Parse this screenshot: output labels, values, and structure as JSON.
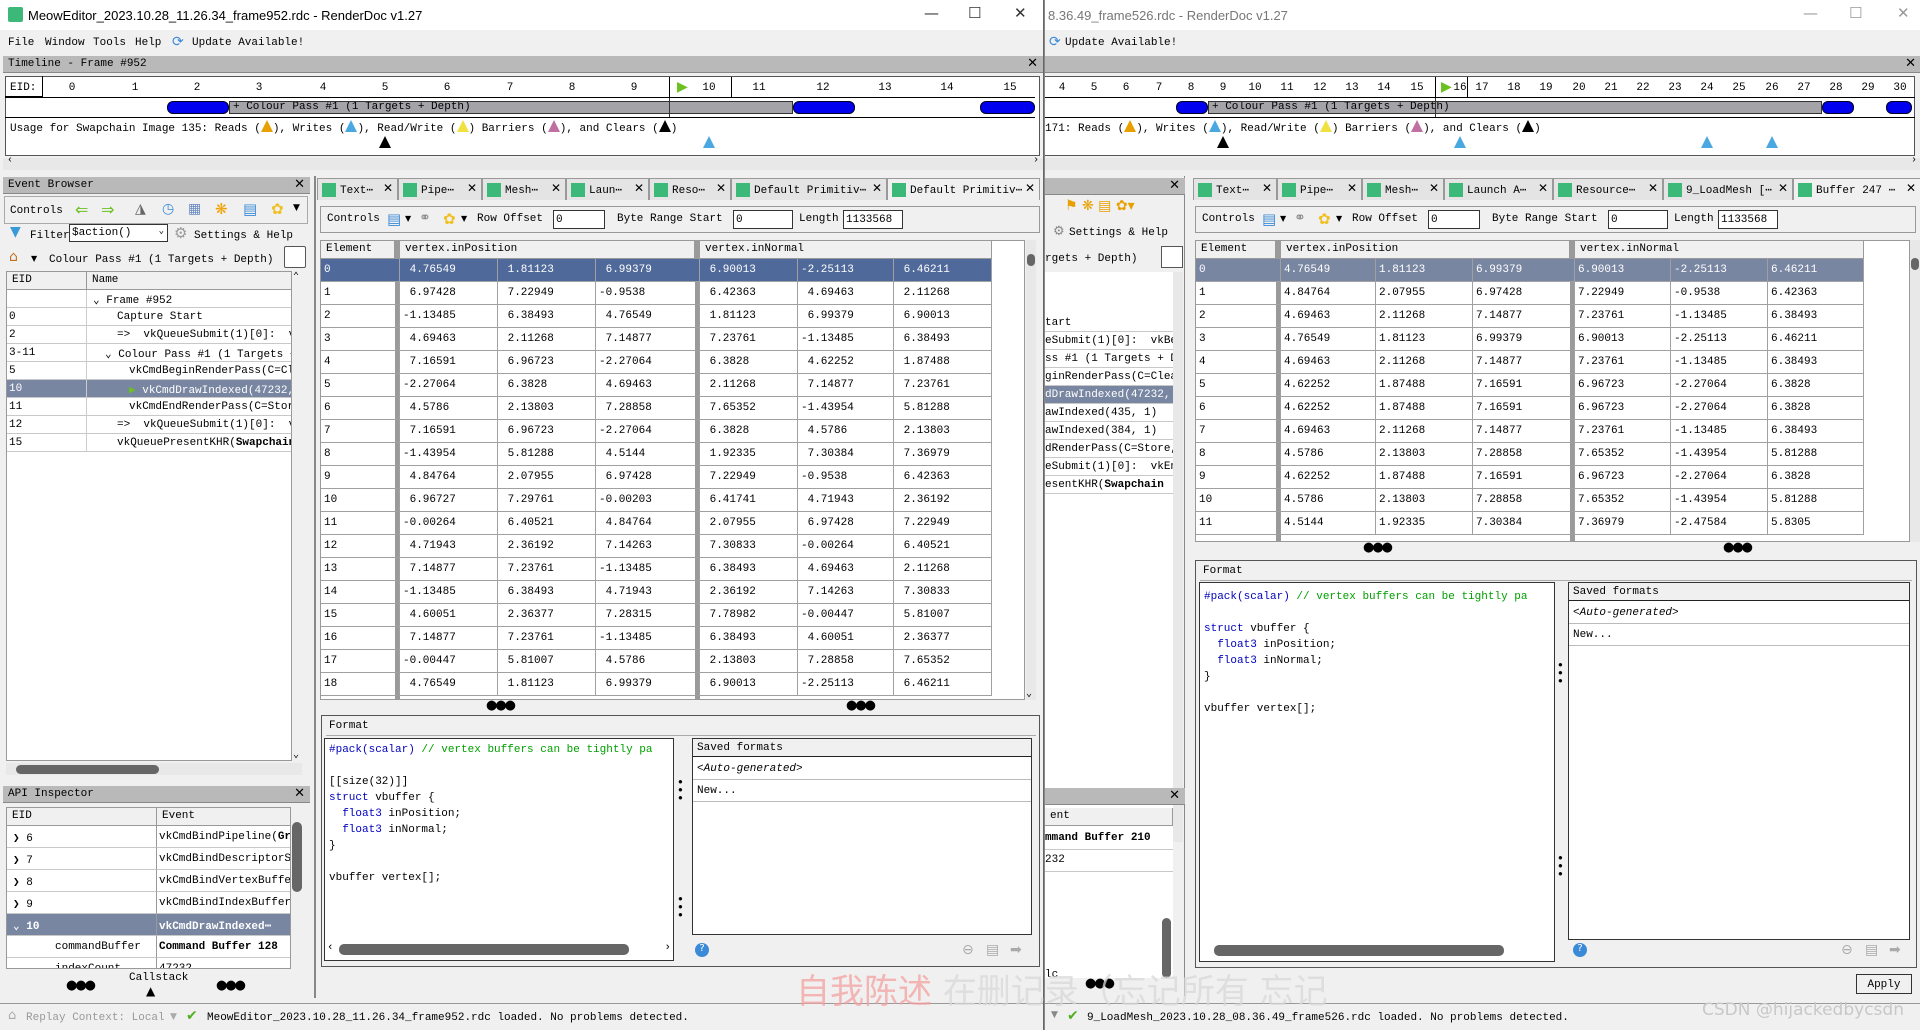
{
  "colors": {
    "accent_selected": "#4f6a9a",
    "inactive_selected": "#7886a2",
    "pass_blue": "#0000ee",
    "pass_gray": "#a4a4a8",
    "reads": "#e8a000",
    "writes": "#4aa8e0",
    "read_write": "#f0e040",
    "barriers": "#c070a0",
    "clears": "#000000",
    "keyword": "#0000c0",
    "comment": "#00a000"
  },
  "left": {
    "title": "MeowEditor_2023.10.28_11.26.34_frame952.rdc - RenderDoc v1.27",
    "menu": [
      "File",
      "Window",
      "Tools",
      "Help"
    ],
    "update": "Update Available!",
    "timeline": {
      "title": "Timeline - Frame #952",
      "eid_label": "EID:",
      "ticks": [
        "0",
        "1",
        "2",
        "3",
        "4",
        "5",
        "6",
        "7",
        "8",
        "9",
        "10",
        "11",
        "12",
        "13",
        "14",
        "15"
      ],
      "current_eid": "10",
      "pass_label": "+ Colour Pass #1 (1 Targets + Depth)",
      "usage": {
        "prefix": "Usage for Swapchain Image 135: Reads (",
        "writes": "), Writes (",
        "rw": "), Read/Write (",
        "barriers": ") Barriers (",
        "clears": "), and Clears (",
        "end": ")"
      },
      "markers": [
        {
          "eid": "5",
          "type": "clears"
        },
        {
          "eid": "10",
          "type": "writes"
        }
      ]
    },
    "event_browser": {
      "title": "Event Browser",
      "controls_label": "Controls",
      "filter_label": "Filter",
      "filter_value": "$action()",
      "settings_label": "Settings & Help",
      "breadcrumb": "Colour Pass #1 (1 Targets + Depth)",
      "columns": [
        "EID",
        "Name"
      ],
      "rows": [
        {
          "eid": "",
          "name": "Frame #952",
          "indent": 0,
          "expander": "v"
        },
        {
          "eid": "0",
          "name": "Capture Start",
          "indent": 1
        },
        {
          "eid": "2",
          "name": "=>  vkQueueSubmit(1)[0]:  vkBe",
          "indent": 1
        },
        {
          "eid": "3-11",
          "name": "Colour Pass #1 (1 Targets + De",
          "indent": 1,
          "expander": "v"
        },
        {
          "eid": "5",
          "name": "vkCmdBeginRenderPass(C=Clear",
          "indent": 2
        },
        {
          "eid": "10",
          "name": "vkCmdDrawIndexed(47232,",
          "indent": 2,
          "selected": true,
          "flag": true
        },
        {
          "eid": "11",
          "name": "vkCmdEndRenderPass(C=Store,",
          "indent": 2
        },
        {
          "eid": "12",
          "name": "=>  vkQueueSubmit(1)[0]:  vkEn",
          "indent": 1
        },
        {
          "eid": "15",
          "name": "vkQueuePresentKHR(",
          "bold": "Swapchain",
          "indent": 1
        }
      ]
    },
    "api_inspector": {
      "title": "API Inspector",
      "columns": [
        "EID",
        "Event"
      ],
      "rows": [
        {
          "eid": "6",
          "event": "vkCmdBindPipeline(",
          "bold": "Gra",
          "exp": ">"
        },
        {
          "eid": "7",
          "event": "vkCmdBindDescriptorSet",
          "exp": ">"
        },
        {
          "eid": "8",
          "event": "vkCmdBindVertexBuffers",
          "exp": ">"
        },
        {
          "eid": "9",
          "event": "vkCmdBindIndexBuffer(I",
          "exp": ">"
        },
        {
          "eid": "10",
          "event": "",
          "bold": "vkCmdDrawIndexed⋯",
          "exp": "v",
          "selected": true
        },
        {
          "eid": "commandBuffer",
          "event": "",
          "bold": "Command Buffer 128",
          "child": true
        },
        {
          "eid": "indexCount",
          "event": "47232",
          "child": true
        }
      ],
      "callstack": "Callstack"
    },
    "tabs": [
      "Text⋯",
      "Pipe⋯",
      "Mesh⋯",
      "Laun⋯",
      "Reso⋯",
      "Default Primitiv⋯",
      "Default Primitiv⋯"
    ],
    "controls": {
      "label": "Controls",
      "row_offset_label": "Row Offset",
      "row_offset": "0",
      "byte_start_label": "Byte Range Start",
      "byte_start": "0",
      "length_label": "Length",
      "length": "1133568"
    },
    "table": {
      "headers": [
        "Element",
        "vertex.inPosition",
        "vertex.inNormal"
      ],
      "rows": [
        [
          "0",
          "4.76549",
          "1.81123",
          "6.99379",
          "6.90013",
          "-2.25113",
          "6.46211"
        ],
        [
          "1",
          "6.97428",
          "7.22949",
          "-0.9538",
          "6.42363",
          "4.69463",
          "2.11268"
        ],
        [
          "2",
          "-1.13485",
          "6.38493",
          "4.76549",
          "1.81123",
          "6.99379",
          "6.90013"
        ],
        [
          "3",
          "4.69463",
          "2.11268",
          "7.14877",
          "7.23761",
          "-1.13485",
          "6.38493"
        ],
        [
          "4",
          "7.16591",
          "6.96723",
          "-2.27064",
          "6.3828",
          "4.62252",
          "1.87488"
        ],
        [
          "5",
          "-2.27064",
          "6.3828",
          "4.69463",
          "2.11268",
          "7.14877",
          "7.23761"
        ],
        [
          "6",
          "4.5786",
          "2.13803",
          "7.28858",
          "7.65352",
          "-1.43954",
          "5.81288"
        ],
        [
          "7",
          "7.16591",
          "6.96723",
          "-2.27064",
          "6.3828",
          "4.5786",
          "2.13803"
        ],
        [
          "8",
          "-1.43954",
          "5.81288",
          "4.5144",
          "1.92335",
          "7.30384",
          "7.36979"
        ],
        [
          "9",
          "4.84764",
          "2.07955",
          "6.97428",
          "7.22949",
          "-0.9538",
          "6.42363"
        ],
        [
          "10",
          "6.96727",
          "7.29761",
          "-0.00203",
          "6.41741",
          "4.71943",
          "2.36192"
        ],
        [
          "11",
          "-0.00264",
          "6.40521",
          "4.84764",
          "2.07955",
          "6.97428",
          "7.22949"
        ],
        [
          "12",
          "4.71943",
          "2.36192",
          "7.14263",
          "7.30833",
          "-0.00264",
          "6.40521"
        ],
        [
          "13",
          "7.14877",
          "7.23761",
          "-1.13485",
          "6.38493",
          "4.69463",
          "2.11268"
        ],
        [
          "14",
          "-1.13485",
          "6.38493",
          "4.71943",
          "2.36192",
          "7.14263",
          "7.30833"
        ],
        [
          "15",
          "4.60051",
          "2.36377",
          "7.28315",
          "7.78982",
          "-0.00447",
          "5.81007"
        ],
        [
          "16",
          "7.14877",
          "7.23761",
          "-1.13485",
          "6.38493",
          "4.60051",
          "2.36377"
        ],
        [
          "17",
          "-0.00447",
          "5.81007",
          "4.5786",
          "2.13803",
          "7.28858",
          "7.65352"
        ],
        [
          "18",
          "4.76549",
          "1.81123",
          "6.99379",
          "6.90013",
          "-2.25113",
          "6.46211"
        ]
      ]
    },
    "format": {
      "title": "Format",
      "pack": "#pack(scalar)",
      "comment": " // vertex buffers can be tightly pa",
      "attr": "[[size(32)]]",
      "struct_kw": "struct",
      "struct_name": " vbuffer {",
      "type1": "float3",
      "field1": " inPosition;",
      "type2": "float3",
      "field2": " inNormal;",
      "close": "}",
      "decl": "vbuffer vertex[];"
    },
    "saved_formats": {
      "title": "Saved formats",
      "items": [
        "<Auto-generated>",
        "New..."
      ]
    },
    "status": {
      "replay_context": "Replay Context: Local",
      "message": "MeowEditor_2023.10.28_11.26.34_frame952.rdc loaded.  No problems detected."
    }
  },
  "right": {
    "title": "8.36.49_frame526.rdc - RenderDoc v1.27",
    "update": "Update Available!",
    "timeline": {
      "ticks": [
        "4",
        "5",
        "6",
        "7",
        "8",
        "9",
        "10",
        "11",
        "12",
        "13",
        "14",
        "15",
        "16",
        "17",
        "18",
        "19",
        "20",
        "21",
        "22",
        "23",
        "24",
        "25",
        "26",
        "27",
        "28",
        "29",
        "30"
      ],
      "current_eid": "16",
      "pass_label": "+ Colour Pass #1 (1 Targets + Depth)",
      "usage": {
        "prefix": "171: Reads (",
        "writes": "), Writes (",
        "rw": "), Read/Write (",
        "barriers": ") Barriers (",
        "clears": "), and Clears (",
        "end": ")"
      },
      "markers": [
        {
          "eid": "9",
          "type": "clears"
        },
        {
          "eid": "16",
          "type": "writes"
        },
        {
          "eid": "24",
          "type": "writes"
        },
        {
          "eid": "26",
          "type": "writes"
        }
      ]
    },
    "event_browser": {
      "settings_label": "Settings & Help",
      "breadcrumb": "rgets + Depth)",
      "rows": [
        "tart",
        "eSubmit(1)[0]:  vkBe",
        "ss #1 (1 Targets + De",
        "ginRenderPass(C=Clear",
        "dDrawIndexed(47232,",
        "awIndexed(435, 1)",
        "awIndexed(384, 1)",
        "dRenderPass(C=Store,",
        "eSubmit(1)[0]:  vkEn",
        "esentKHR("
      ],
      "last_bold": "Swapchain"
    },
    "api_inspector": {
      "column": "ent",
      "rows": [
        "mmand Buffer 210",
        "232"
      ],
      "callstack": "lc"
    },
    "tabs": [
      "Text⋯",
      "Pipe⋯",
      "Mesh⋯",
      "Launch A⋯",
      "Resource⋯",
      "9_LoadMesh [⋯",
      "Buffer 247 ⋯"
    ],
    "controls": {
      "label": "Controls",
      "row_offset_label": "Row Offset",
      "row_offset": "0",
      "byte_start_label": "Byte Range Start",
      "byte_start": "0",
      "length_label": "Length",
      "length": "1133568"
    },
    "table": {
      "headers": [
        "Element",
        "vertex.inPosition",
        "vertex.inNormal"
      ],
      "rows": [
        [
          "0",
          "4.76549",
          "1.81123",
          "6.99379",
          "6.90013",
          "-2.25113",
          "6.46211"
        ],
        [
          "1",
          "4.84764",
          "2.07955",
          "6.97428",
          "7.22949",
          "-0.9538",
          "6.42363"
        ],
        [
          "2",
          "4.69463",
          "2.11268",
          "7.14877",
          "7.23761",
          "-1.13485",
          "6.38493"
        ],
        [
          "3",
          "4.76549",
          "1.81123",
          "6.99379",
          "6.90013",
          "-2.25113",
          "6.46211"
        ],
        [
          "4",
          "4.69463",
          "2.11268",
          "7.14877",
          "7.23761",
          "-1.13485",
          "6.38493"
        ],
        [
          "5",
          "4.62252",
          "1.87488",
          "7.16591",
          "6.96723",
          "-2.27064",
          "6.3828"
        ],
        [
          "6",
          "4.62252",
          "1.87488",
          "7.16591",
          "6.96723",
          "-2.27064",
          "6.3828"
        ],
        [
          "7",
          "4.69463",
          "2.11268",
          "7.14877",
          "7.23761",
          "-1.13485",
          "6.38493"
        ],
        [
          "8",
          "4.5786",
          "2.13803",
          "7.28858",
          "7.65352",
          "-1.43954",
          "5.81288"
        ],
        [
          "9",
          "4.62252",
          "1.87488",
          "7.16591",
          "6.96723",
          "-2.27064",
          "6.3828"
        ],
        [
          "10",
          "4.5786",
          "2.13803",
          "7.28858",
          "7.65352",
          "-1.43954",
          "5.81288"
        ],
        [
          "11",
          "4.5144",
          "1.92335",
          "7.30384",
          "7.36979",
          "-2.47584",
          "5.8305"
        ]
      ]
    },
    "format": {
      "title": "Format",
      "pack": "#pack(scalar)",
      "comment": " // vertex buffers can be tightly pa",
      "struct_kw": "struct",
      "struct_name": " vbuffer {",
      "type1": "float3",
      "field1": " inPosition;",
      "type2": "float3",
      "field2": " inNormal;",
      "close": "}",
      "decl": "vbuffer vertex[];"
    },
    "saved_formats": {
      "title": "Saved formats",
      "items": [
        "<Auto-generated>",
        "New..."
      ]
    },
    "apply": "Apply",
    "status": {
      "message": "9_LoadMesh_2023.10.28_08.36.49_frame526.rdc loaded.  No problems detected."
    }
  },
  "overlay": {
    "watermark_red": "自我陈述",
    "watermark_gray": "在删记录（忘记所有 忘记",
    "csdn": "CSDN @hijackedbycsdn"
  }
}
